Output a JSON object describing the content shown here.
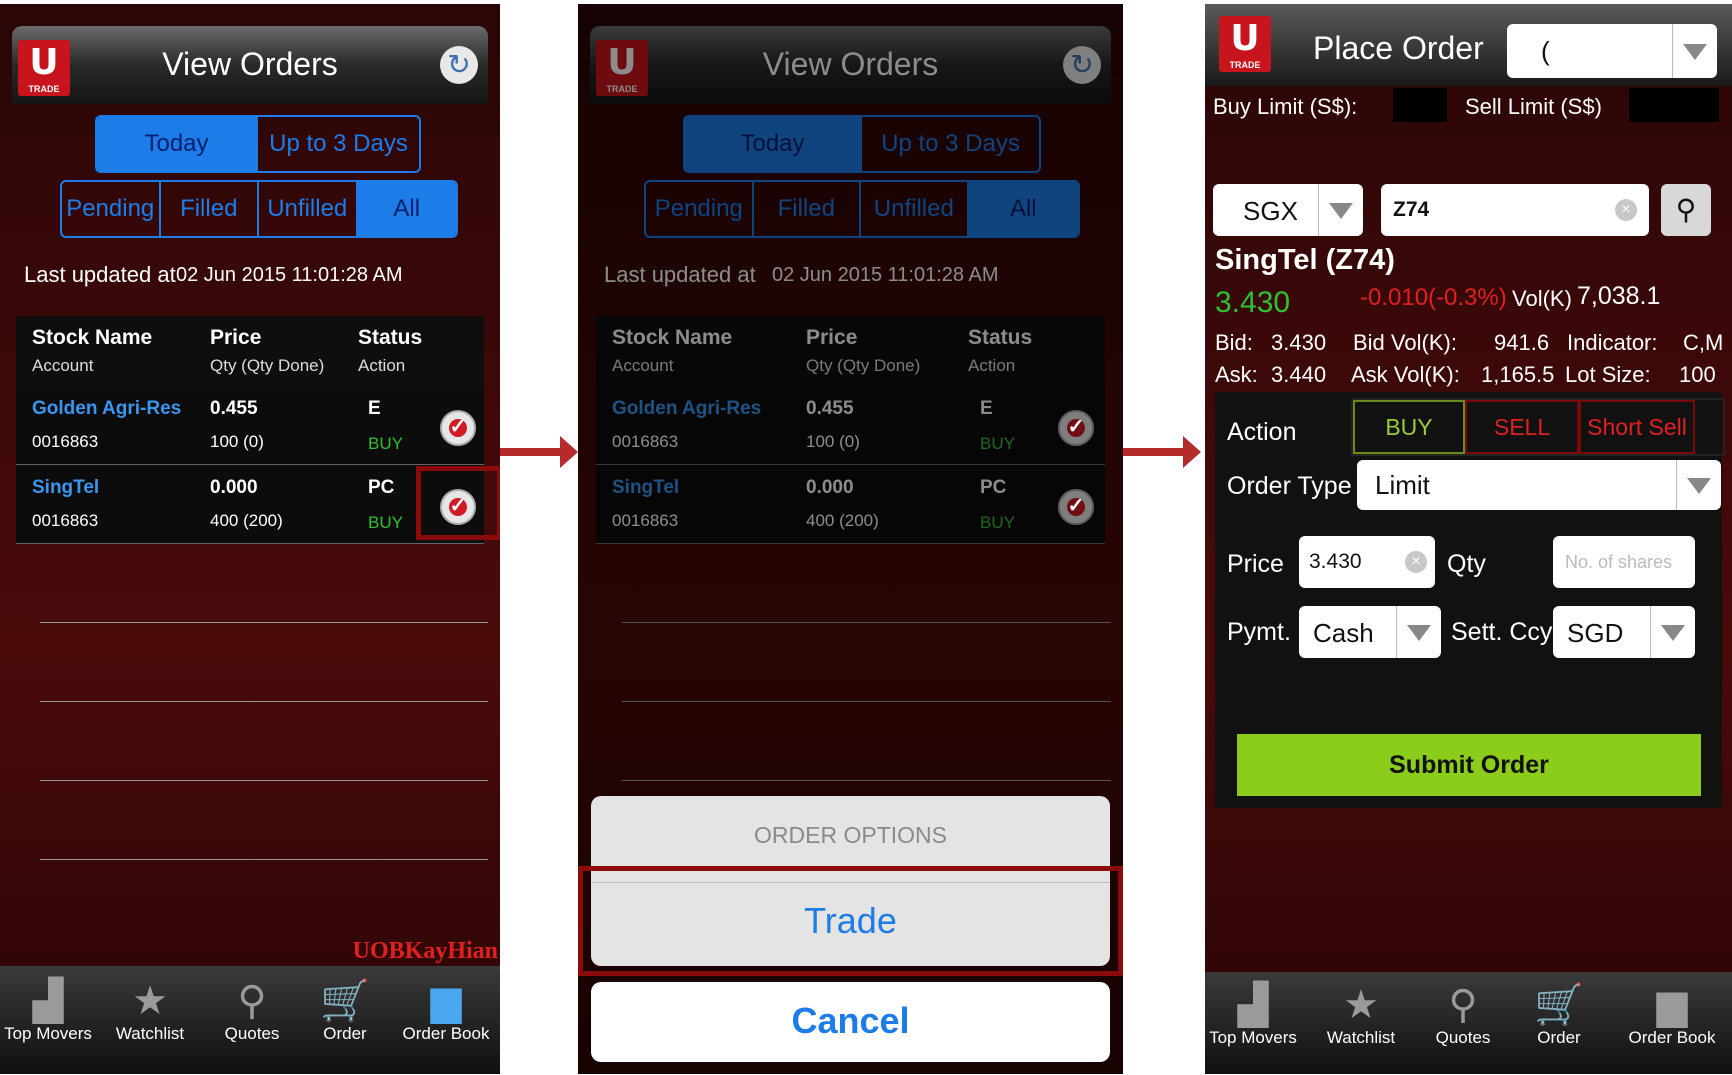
{
  "logo": {
    "letter": "U",
    "sub": "TRADE"
  },
  "view_orders": {
    "title": "View Orders",
    "period_tabs": [
      "Today",
      "Up to 3 Days"
    ],
    "filter_tabs": [
      "Pending",
      "Filled",
      "Unfilled",
      "All"
    ],
    "last_updated_label": "Last updated at",
    "last_updated_value": "02 Jun 2015 11:01:28 AM",
    "headers": {
      "col1": "Stock Name",
      "col1_sub": "Account",
      "col2": "Price",
      "col2_sub": "Qty (Qty Done)",
      "col3": "Status",
      "col3_sub": "Action"
    },
    "orders": [
      {
        "name": "Golden Agri-Res",
        "account": "0016863",
        "price": "0.455",
        "qty": "100 (0)",
        "status": "E",
        "action": "BUY"
      },
      {
        "name": "SingTel",
        "account": "0016863",
        "price": "0.000",
        "qty": "400 (200)",
        "status": "PC",
        "action": "BUY"
      }
    ],
    "brand": "UOBKayHian"
  },
  "tabbar": {
    "items": [
      {
        "label": "Top Movers",
        "icon": "chart-icon"
      },
      {
        "label": "Watchlist",
        "icon": "star-icon"
      },
      {
        "label": "Quotes",
        "icon": "search-icon"
      },
      {
        "label": "Order",
        "icon": "cart-icon"
      },
      {
        "label": "Order Book",
        "icon": "folder-icon"
      }
    ]
  },
  "action_sheet": {
    "header": "ORDER OPTIONS",
    "trade": "Trade",
    "cancel": "Cancel"
  },
  "place_order": {
    "title": "Place Order",
    "account_value": "(",
    "buy_limit_label": "Buy Limit (S$):",
    "sell_limit_label": "Sell Limit (S$)",
    "exchange": "SGX",
    "symbol": "Z74",
    "stock_title": "SingTel (Z74)",
    "last_price": "3.430",
    "change": "-0.010(-0.3%)",
    "vol_label": "Vol(K)",
    "vol_value": "7,038.1",
    "bid_label": "Bid:",
    "bid_value": "3.430",
    "bid_vol_label": "Bid Vol(K):",
    "bid_vol_value": "941.6",
    "indicator_label": "Indicator:",
    "indicator_value": "C,M",
    "ask_label": "Ask:",
    "ask_value": "3.440",
    "ask_vol_label": "Ask Vol(K):",
    "ask_vol_value": "1,165.5",
    "lot_label": "Lot Size:",
    "lot_value": "100",
    "action_label": "Action",
    "actions": [
      "BUY",
      "SELL",
      "Short Sell"
    ],
    "order_type_label": "Order Type",
    "order_type_value": "Limit",
    "price_label": "Price",
    "price_value": "3.430",
    "qty_label": "Qty",
    "qty_placeholder": "No. of shares",
    "pymt_label": "Pymt.",
    "pymt_value": "Cash",
    "sett_label": "Sett. Ccy",
    "sett_value": "SGD",
    "submit": "Submit Order"
  },
  "colors": {
    "accent_blue": "#1c7ce8",
    "buy_green": "#2ec22e",
    "sell_red": "#e02020",
    "highlight": "#8b0a0a",
    "submit_green": "#8ccc1a"
  }
}
